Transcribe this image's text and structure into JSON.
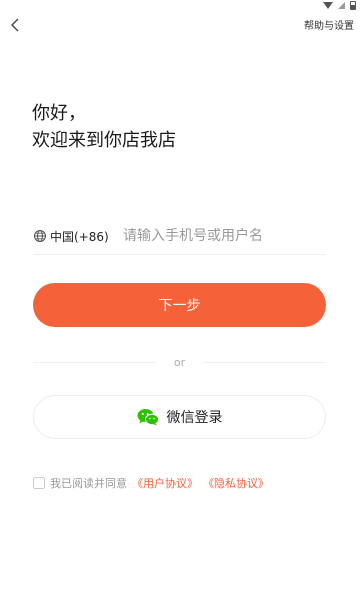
{
  "status_bar": {
    "icons": [
      "wifi-icon",
      "signal-icon",
      "battery-icon"
    ]
  },
  "nav": {
    "back_icon": "chevron-left-icon",
    "help_label": "帮助与设置"
  },
  "greeting": {
    "line1": "你好，",
    "line2": "欢迎来到你店我店"
  },
  "login_form": {
    "country_icon": "globe-icon",
    "country_label": "中国(+86)",
    "phone_placeholder": "请输入手机号或用户名",
    "phone_value": "",
    "next_label": "下一步"
  },
  "divider": {
    "label": "or"
  },
  "wechat_login": {
    "icon": "wechat-icon",
    "label": "微信登录"
  },
  "agreement": {
    "checked": false,
    "prefix": "我已阅读并同意",
    "user_agreement_label": "《用户协议》",
    "privacy_agreement_label": "《隐私协议》"
  },
  "colors": {
    "accent": "#f4623a",
    "wechat_green": "#2dc100",
    "text_primary": "#222222",
    "text_muted": "#999999"
  }
}
